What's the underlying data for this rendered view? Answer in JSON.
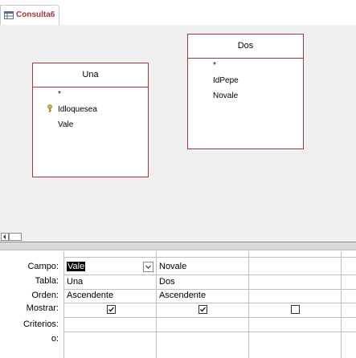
{
  "tab": {
    "title": "Consulta6",
    "icon": "query-icon"
  },
  "tables": [
    {
      "title": "Una",
      "fields": [
        "*",
        "Idloquesea",
        "Vale"
      ],
      "key_field": "Idloquesea"
    },
    {
      "title": "Dos",
      "fields": [
        "*",
        "IdPepe",
        "Novale"
      ]
    }
  ],
  "grid": {
    "row_labels": [
      "Campo:",
      "Tabla:",
      "Orden:",
      "Mostrar:",
      "Criterios:",
      "o:"
    ],
    "columns": [
      {
        "campo": "Vale",
        "tabla": "Una",
        "orden": "Ascendente",
        "mostrar": true
      },
      {
        "campo": "Novale",
        "tabla": "Dos",
        "orden": "Ascendente",
        "mostrar": true
      },
      {
        "campo": "",
        "tabla": "",
        "orden": "",
        "mostrar": false
      }
    ]
  },
  "colors": {
    "accent": "#a4373a",
    "canvas": "#f0f0f0"
  }
}
